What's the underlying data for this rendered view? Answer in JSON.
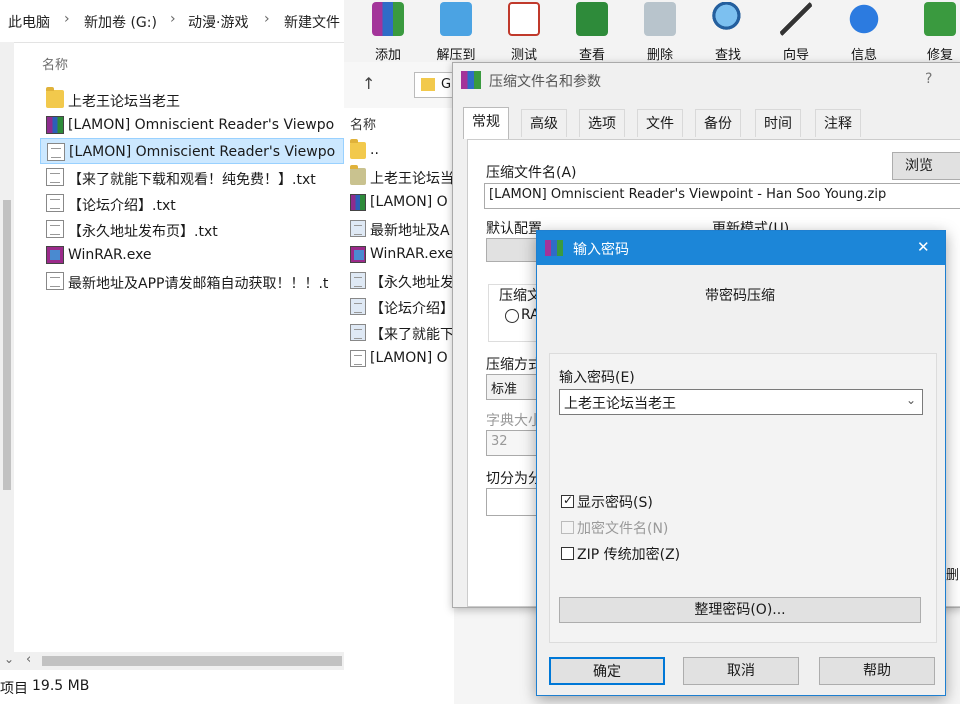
{
  "explorer": {
    "breadcrumb": [
      "此电脑",
      "新加卷 (G:)",
      "动漫·游戏",
      "新建文件"
    ],
    "column_header": "名称",
    "files": [
      {
        "name": "上老王论坛当老王",
        "icon": "folder-icon"
      },
      {
        "name": "[LAMON] Omniscient Reader's Viewpo",
        "icon": "rar-archive-icon"
      },
      {
        "name": "[LAMON] Omniscient Reader's Viewpo",
        "icon": "blank-file-icon",
        "selected": true
      },
      {
        "name": "【来了就能下载和观看！纯免费！】.txt",
        "icon": "text-file-icon"
      },
      {
        "name": "【论坛介绍】.txt",
        "icon": "text-file-icon"
      },
      {
        "name": "【永久地址发布页】.txt",
        "icon": "text-file-icon"
      },
      {
        "name": "WinRAR.exe",
        "icon": "winrar-exe-icon"
      },
      {
        "name": "最新地址及APP请发邮箱自动获取！！！.t",
        "icon": "text-file-icon"
      }
    ],
    "status_left": "项目",
    "status_size": "19.5 MB"
  },
  "winrar": {
    "toolbar": [
      {
        "label": "添加",
        "icon": "add-books-icon"
      },
      {
        "label": "解压到",
        "icon": "extract-folder-icon"
      },
      {
        "label": "测试",
        "icon": "test-clipboard-icon"
      },
      {
        "label": "查看",
        "icon": "view-book-icon"
      },
      {
        "label": "删除",
        "icon": "trash-icon"
      },
      {
        "label": "查找",
        "icon": "magnifier-icon"
      },
      {
        "label": "向导",
        "icon": "wand-icon"
      },
      {
        "label": "信息",
        "icon": "info-icon"
      },
      {
        "label": "修复",
        "icon": "repair-icon"
      }
    ],
    "path_fragment": "G",
    "list_header": "名称",
    "list": [
      {
        "name": "..",
        "icon": "folder-icon"
      },
      {
        "name": "上老王论坛当",
        "icon": "folder-icon"
      },
      {
        "name": "[LAMON] O",
        "icon": "rar-archive-icon"
      },
      {
        "name": "最新地址及A",
        "icon": "text-file-icon"
      },
      {
        "name": "WinRAR.exe",
        "icon": "winrar-exe-icon"
      },
      {
        "name": "【永久地址发",
        "icon": "text-file-icon"
      },
      {
        "name": "【论坛介绍】",
        "icon": "text-file-icon"
      },
      {
        "name": "【来了就能下",
        "icon": "text-file-icon"
      },
      {
        "name": "[LAMON] O",
        "icon": "blank-file-icon"
      }
    ]
  },
  "archive_dialog": {
    "title": "压缩文件名和参数",
    "help": "?",
    "tabs": [
      "常规",
      "高级",
      "选项",
      "文件",
      "备份",
      "时间",
      "注释"
    ],
    "archive_name_label": "压缩文件名(A)",
    "browse_button": "浏览(B)...",
    "archive_name_value": "[LAMON] Omniscient Reader's Viewpoint - Han Soo Young.zip",
    "default_profile_label": "默认配置",
    "update_mode_label": "更新模式(U)",
    "format_label": "压缩文",
    "format_option": "RA",
    "method_label": "压缩方式",
    "method_value": "标准",
    "dict_label": "字典大小",
    "dict_value": "32",
    "split_label": "切分为分",
    "right_edge_fragment": "删"
  },
  "password_dialog": {
    "title": "输入密码",
    "close": "✕",
    "heading": "带密码压缩",
    "password_label": "输入密码(E)",
    "password_value": "上老王论坛当老王",
    "show_password": "显示密码(S)",
    "show_password_checked": true,
    "encrypt_names": "加密文件名(N)",
    "encrypt_names_checked": false,
    "zip_legacy": "ZIP 传统加密(Z)",
    "zip_legacy_checked": false,
    "organize_button": "整理密码(O)...",
    "ok_button": "确定",
    "cancel_button": "取消",
    "help_button": "帮助"
  },
  "colors": {
    "accent": "#1c86d8",
    "selection": "#cce8ff",
    "folder": "#f2c94c"
  }
}
